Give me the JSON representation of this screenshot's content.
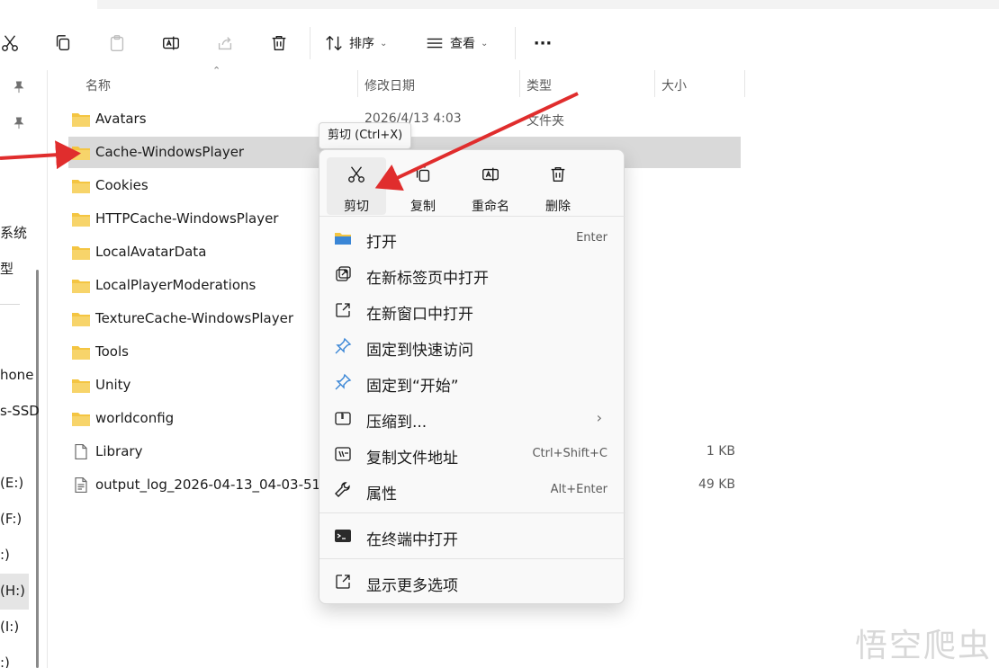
{
  "toolbar": {
    "sort_label": "排序",
    "view_label": "查看",
    "more_label": "···"
  },
  "nav": {
    "items": [
      "系统",
      "型",
      "hone",
      "s-SSD",
      "(E:)",
      "(F:)",
      ":)",
      "(H:)",
      "(I:)",
      ":)"
    ]
  },
  "columns": {
    "name": "名称",
    "date": "修改日期",
    "type": "类型",
    "size": "大小"
  },
  "files": [
    {
      "name": "Avatars",
      "date": "2026/4/13 4:03",
      "type": "文件夹",
      "size": ""
    },
    {
      "name": "Cache-WindowsPlayer",
      "date": "",
      "type": "",
      "size": ""
    },
    {
      "name": "Cookies",
      "date": "",
      "type": "",
      "size": ""
    },
    {
      "name": "HTTPCache-WindowsPlayer",
      "date": "",
      "type": "",
      "size": ""
    },
    {
      "name": "LocalAvatarData",
      "date": "",
      "type": "",
      "size": ""
    },
    {
      "name": "LocalPlayerModerations",
      "date": "",
      "type": "",
      "size": ""
    },
    {
      "name": "TextureCache-WindowsPlayer",
      "date": "",
      "type": "",
      "size": ""
    },
    {
      "name": "Tools",
      "date": "",
      "type": "",
      "size": ""
    },
    {
      "name": "Unity",
      "date": "",
      "type": "",
      "size": ""
    },
    {
      "name": "worldconfig",
      "date": "",
      "type": "",
      "size": ""
    },
    {
      "name": "Library",
      "date": "",
      "type": "",
      "size": "1 KB"
    },
    {
      "name": "output_log_2026-04-13_04-03-51",
      "date": "",
      "type": "",
      "size": "49 KB"
    }
  ],
  "tooltip": "剪切 (Ctrl+X)",
  "menu": {
    "top": [
      {
        "label": "剪切",
        "icon": "cut-icon"
      },
      {
        "label": "复制",
        "icon": "copy-icon"
      },
      {
        "label": "重命名",
        "icon": "rename-icon"
      },
      {
        "label": "删除",
        "icon": "delete-icon"
      }
    ],
    "items": [
      {
        "label": "打开",
        "shortcut": "Enter",
        "icon": "folder-icon"
      },
      {
        "label": "在新标签页中打开",
        "shortcut": "",
        "icon": "new-tab-icon"
      },
      {
        "label": "在新窗口中打开",
        "shortcut": "",
        "icon": "new-window-icon"
      },
      {
        "label": "固定到快速访问",
        "shortcut": "",
        "icon": "pin-icon"
      },
      {
        "label": "固定到“开始”",
        "shortcut": "",
        "icon": "pin-icon"
      },
      {
        "label": "压缩到...",
        "shortcut": "",
        "icon": "zip-icon"
      },
      {
        "label": "复制文件地址",
        "shortcut": "Ctrl+Shift+C",
        "icon": "copy-path-icon"
      },
      {
        "label": "属性",
        "shortcut": "Alt+Enter",
        "icon": "wrench-icon"
      },
      {
        "label": "在终端中打开",
        "shortcut": "",
        "icon": "terminal-icon"
      },
      {
        "label": "显示更多选项",
        "shortcut": "",
        "icon": "more-options-icon"
      }
    ]
  },
  "watermark": "悟空爬虫",
  "colors": {
    "folder": "#f4c542",
    "arrow": "#e02d2d",
    "selected_row": "#d9d9d9",
    "menu_bg": "#f9f9f9"
  }
}
